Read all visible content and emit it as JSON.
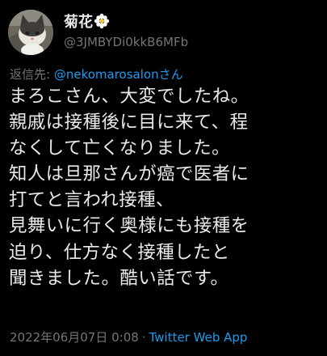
{
  "author": {
    "display_name": "菊花",
    "handle": "@3JMBYDi0kkB6MFb",
    "avatar_icon": "cat-photo-avatar",
    "name_emoji_icon": "white-flower-icon"
  },
  "reply": {
    "prefix": "返信先: ",
    "mention": "@nekomarosalonさん"
  },
  "tweet": {
    "lines": [
      "まろこさん、大変でしたね。",
      "親戚は接種後に目に来て、程",
      "なくして亡くなりました。",
      "知人は旦那さんが癌で医者に",
      "打てと言われ接種、",
      "見舞いに行く奥様にも接種を",
      "迫り、仕方なく接種したと",
      "聞きました。酷い話です。"
    ]
  },
  "meta": {
    "timestamp": "2022年06月07日 0:08",
    "separator": "·",
    "source": "Twitter Web App"
  },
  "colors": {
    "background": "#000000",
    "text": "#e7e9ea",
    "muted": "#71767b",
    "link": "#1d9bf0"
  }
}
